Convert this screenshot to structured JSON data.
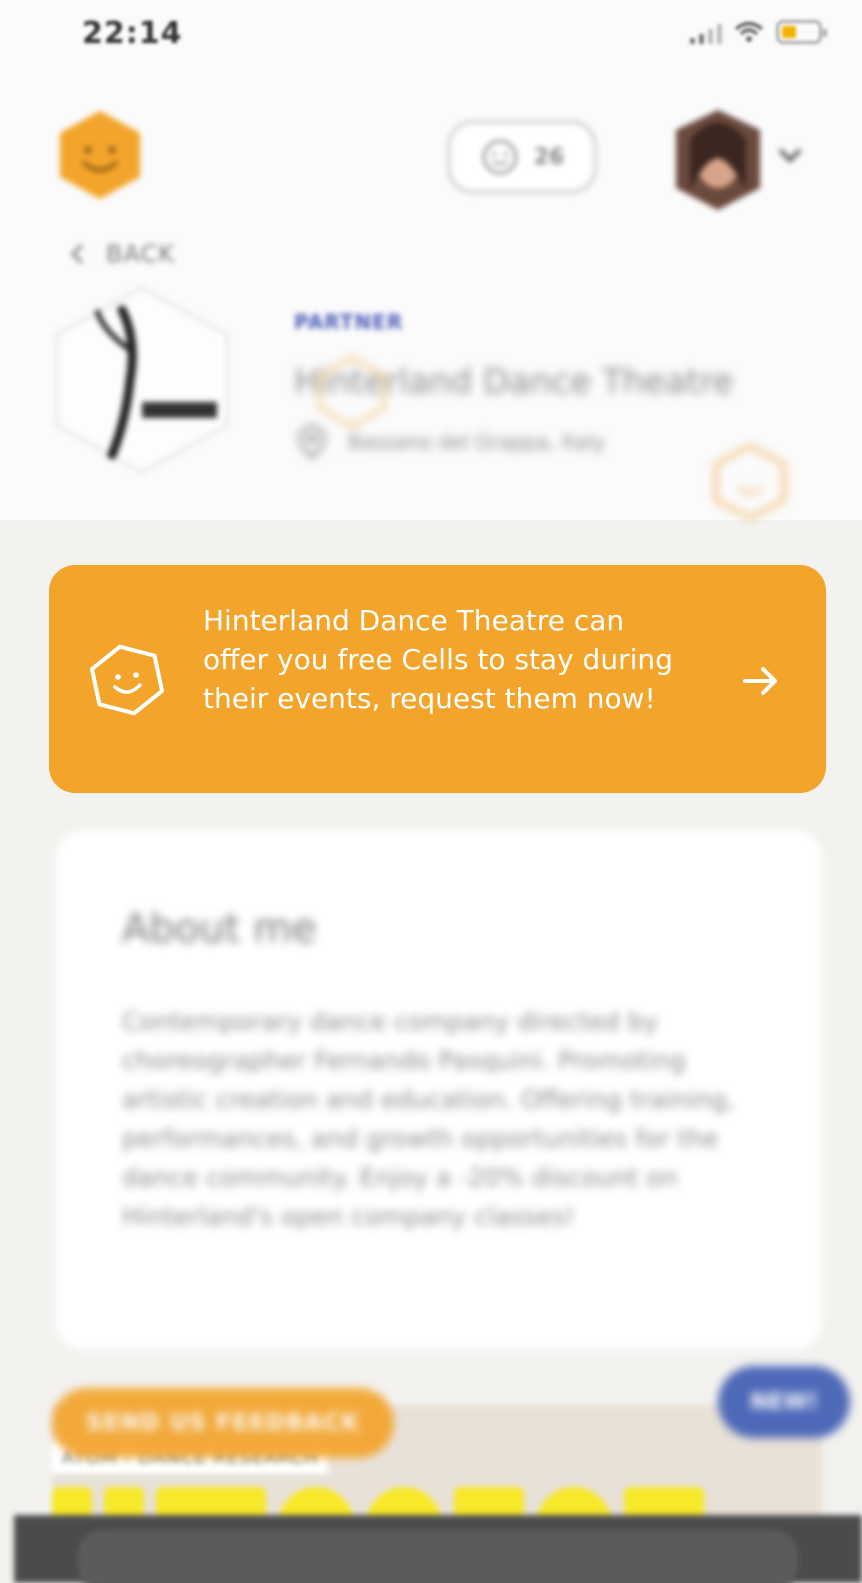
{
  "status_bar": {
    "time": "22:14"
  },
  "header": {
    "credits": "26"
  },
  "nav": {
    "back_label": "BACK"
  },
  "partner": {
    "label": "PARTNER",
    "name": "Hinterland Dance Theatre",
    "location": "Bassano del Grappa, Italy"
  },
  "banner": {
    "text": "Hinterland Dance Theatre can offer you free Cells to stay during their events, request them now!"
  },
  "about": {
    "title": "About me",
    "text": "Contemporary dance company directed by choreographer Fernando Pasquini. Promoting artistic creation and education. Offering training, performances, and growth opportunities for the dance community. Enjoy a -20% discount on Hinterland's open company classes!"
  },
  "gallery": {
    "strip_label": "ATOM - DANCE RESEARCH"
  },
  "floating": {
    "feedback_label": "SEND US FEEDBACK",
    "new_label": "NEW!"
  },
  "colors": {
    "accent_orange": "#f3a42b",
    "partner_blue": "#4c5db8",
    "new_badge_blue": "#4e69b8"
  },
  "icons": {
    "app_logo": "hexagon-smiley-icon",
    "credits": "smiley-icon",
    "back": "chevron-left-icon",
    "location": "location-pin-icon",
    "banner": "hexagon-smiley-icon",
    "banner_arrow": "arrow-right-icon"
  }
}
